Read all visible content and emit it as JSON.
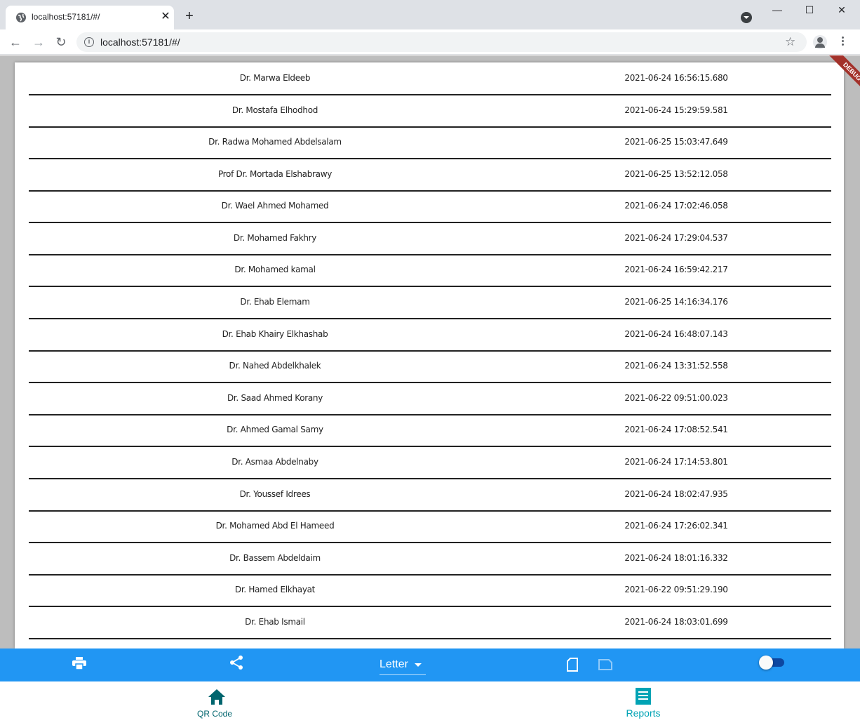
{
  "browser": {
    "tab_title": "localhost:57181/#/",
    "url": "localhost:57181/#/",
    "minimize": "—",
    "maximize": "☐",
    "close": "✕"
  },
  "app": {
    "debug_banner": "DEBUG",
    "rows": [
      {
        "name": "Dr. Marwa Eldeeb",
        "date": "2021-06-24 16:56:15.680"
      },
      {
        "name": "Dr. Mostafa Elhodhod",
        "date": "2021-06-24 15:29:59.581"
      },
      {
        "name": "Dr. Radwa Mohamed Abdelsalam",
        "date": "2021-06-25 15:03:47.649"
      },
      {
        "name": "Prof Dr. Mortada Elshabrawy",
        "date": "2021-06-25 13:52:12.058"
      },
      {
        "name": "Dr. Wael Ahmed Mohamed",
        "date": "2021-06-24 17:02:46.058"
      },
      {
        "name": "Dr. Mohamed Fakhry",
        "date": "2021-06-24 17:29:04.537"
      },
      {
        "name": "Dr. Mohamed kamal",
        "date": "2021-06-24 16:59:42.217"
      },
      {
        "name": "Dr. Ehab Elemam",
        "date": "2021-06-25 14:16:34.176"
      },
      {
        "name": "Dr. Ehab Khairy Elkhashab",
        "date": "2021-06-24 16:48:07.143"
      },
      {
        "name": "Dr. Nahed Abdelkhalek",
        "date": "2021-06-24 13:31:52.558"
      },
      {
        "name": "Dr. Saad Ahmed Korany",
        "date": "2021-06-22 09:51:00.023"
      },
      {
        "name": "Dr. Ahmed Gamal Samy",
        "date": "2021-06-24 17:08:52.541"
      },
      {
        "name": "Dr. Asmaa Abdelnaby",
        "date": "2021-06-24 17:14:53.801"
      },
      {
        "name": "Dr. Youssef Idrees",
        "date": "2021-06-24 18:02:47.935"
      },
      {
        "name": "Dr. Mohamed Abd El Hameed",
        "date": "2021-06-24 17:26:02.341"
      },
      {
        "name": "Dr. Bassem Abdeldaim",
        "date": "2021-06-24 18:01:16.332"
      },
      {
        "name": "Dr. Hamed Elkhayat",
        "date": "2021-06-22 09:51:29.190"
      },
      {
        "name": "Dr. Ehab Ismail",
        "date": "2021-06-24 18:03:01.699"
      }
    ],
    "action_bar": {
      "page_format": "Letter",
      "toggle_on": false
    },
    "bottom_nav": {
      "items": [
        {
          "label": "QR Code",
          "icon": "home-icon",
          "color": "#00656e"
        },
        {
          "label": "Reports",
          "icon": "reports-icon",
          "color": "#00a3b4"
        }
      ]
    }
  },
  "colors": {
    "action_bar": "#2196f3",
    "row_divider": "#222222",
    "debug": "#a3322b"
  }
}
